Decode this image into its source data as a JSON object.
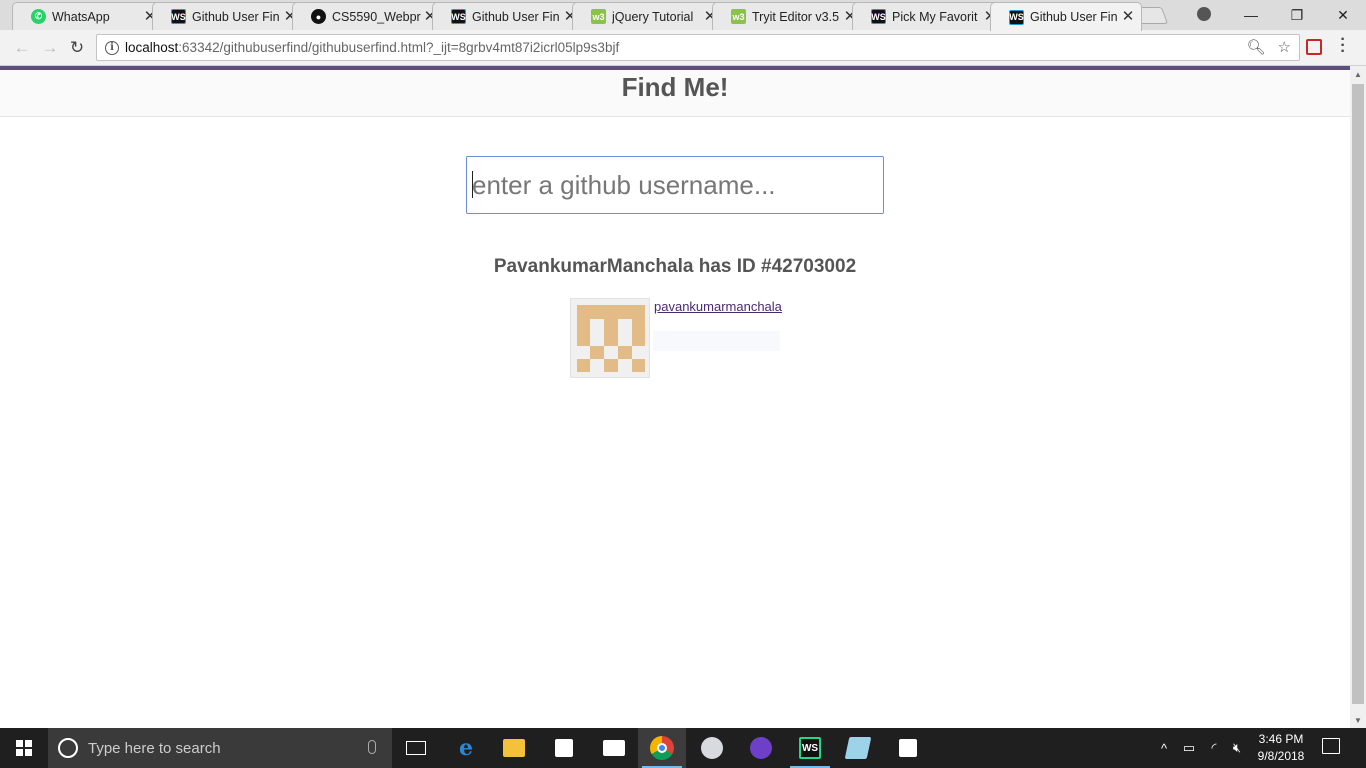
{
  "browser": {
    "tabs": [
      {
        "title": "WhatsApp",
        "icon": "whatsapp-icon",
        "active": false
      },
      {
        "title": "Github User Fin",
        "icon": "webstorm-icon",
        "active": false
      },
      {
        "title": "CS5590_Webpr",
        "icon": "github-icon",
        "active": false
      },
      {
        "title": "Github User Fin",
        "icon": "webstorm-icon",
        "active": false
      },
      {
        "title": "jQuery Tutorial",
        "icon": "w3schools-icon",
        "active": false
      },
      {
        "title": "Tryit Editor v3.5",
        "icon": "w3schools-icon",
        "active": false
      },
      {
        "title": "Pick My Favorit",
        "icon": "webstorm-icon",
        "active": false
      },
      {
        "title": "Github User Fin",
        "icon": "webstorm-icon",
        "active": true
      }
    ],
    "url_host": "localhost",
    "url_rest": ":63342/githubuserfind/githubuserfind.html?_ijt=8grbv4mt87i2icrl05lp9s3bjf"
  },
  "page": {
    "heading": "Find Me!",
    "search_placeholder": "enter a github username...",
    "result_title": "PavankumarManchala has ID #42703002",
    "username_link": "pavankumarmanchala",
    "avatar_color": "#e2bb86"
  },
  "taskbar": {
    "search_placeholder": "Type here to search",
    "time": "3:46 PM",
    "date": "9/8/2018"
  }
}
